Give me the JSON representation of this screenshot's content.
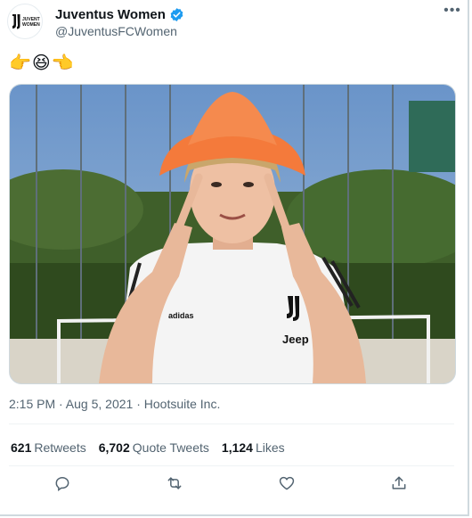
{
  "account": {
    "display_name": "Juventus Women",
    "handle": "@JuventusFCWomen",
    "avatar_text": "JUVENTUS WOMEN"
  },
  "tweet": {
    "text": "👉😆👈",
    "timestamp": "2:15 PM · Aug 5, 2021 · Hootsuite Inc.",
    "media_alt": "Player wearing an orange cone on her head pointing at her temples",
    "jersey_text": "Jeep",
    "brand_text": "adidas"
  },
  "stats": [
    {
      "count": "621",
      "label": "Retweets"
    },
    {
      "count": "6,702",
      "label": "Quote Tweets"
    },
    {
      "count": "1,124",
      "label": "Likes"
    }
  ],
  "actions": [
    "reply-icon",
    "retweet-icon",
    "like-icon",
    "share-icon"
  ],
  "colors": {
    "verified": "#1d9bf0",
    "secondary_text": "#536471",
    "cone": "#f47a3b"
  }
}
